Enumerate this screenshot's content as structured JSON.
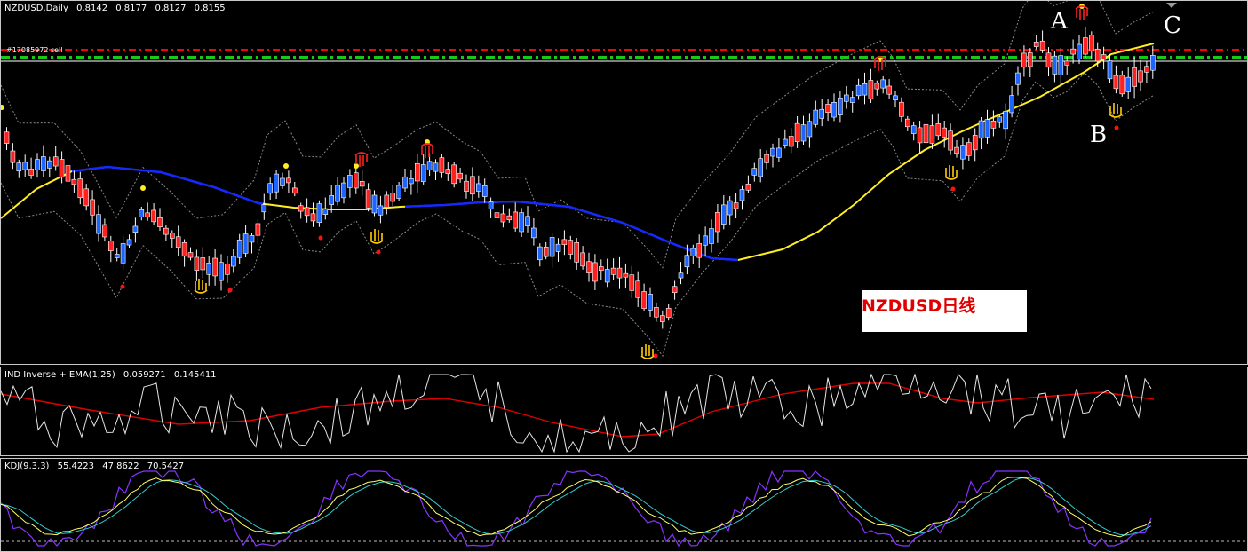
{
  "main_chart": {
    "symbol": "NZDUSD,Daily",
    "ohlc": [
      "0.8142",
      "0.8177",
      "0.8127",
      "0.8155"
    ],
    "order_label": "#17085972 sell",
    "annotation": "NZDUSD日线",
    "labels": {
      "a": "A",
      "b": "B",
      "c": "C"
    },
    "colors": {
      "bull": "#1e64ff",
      "bear": "#ff2020",
      "ma_blue": "#1428ff",
      "ma_yellow": "#ffee22",
      "order_red": "#ff0000",
      "order_green": "#18c818"
    }
  },
  "indicator_panel": {
    "title": "IND Inverse + EMA(1,25)",
    "values": [
      "0.059271",
      "0.145411"
    ],
    "colors": {
      "line": "#e6e6e6",
      "ema": "#e00000"
    }
  },
  "kdj_panel": {
    "title": "KDJ(9,3,3)",
    "values": [
      "55.4223",
      "47.8622",
      "70.5427"
    ],
    "colors": {
      "k": "#ffff66",
      "d": "#33cccc",
      "j": "#8833ff"
    }
  }
}
